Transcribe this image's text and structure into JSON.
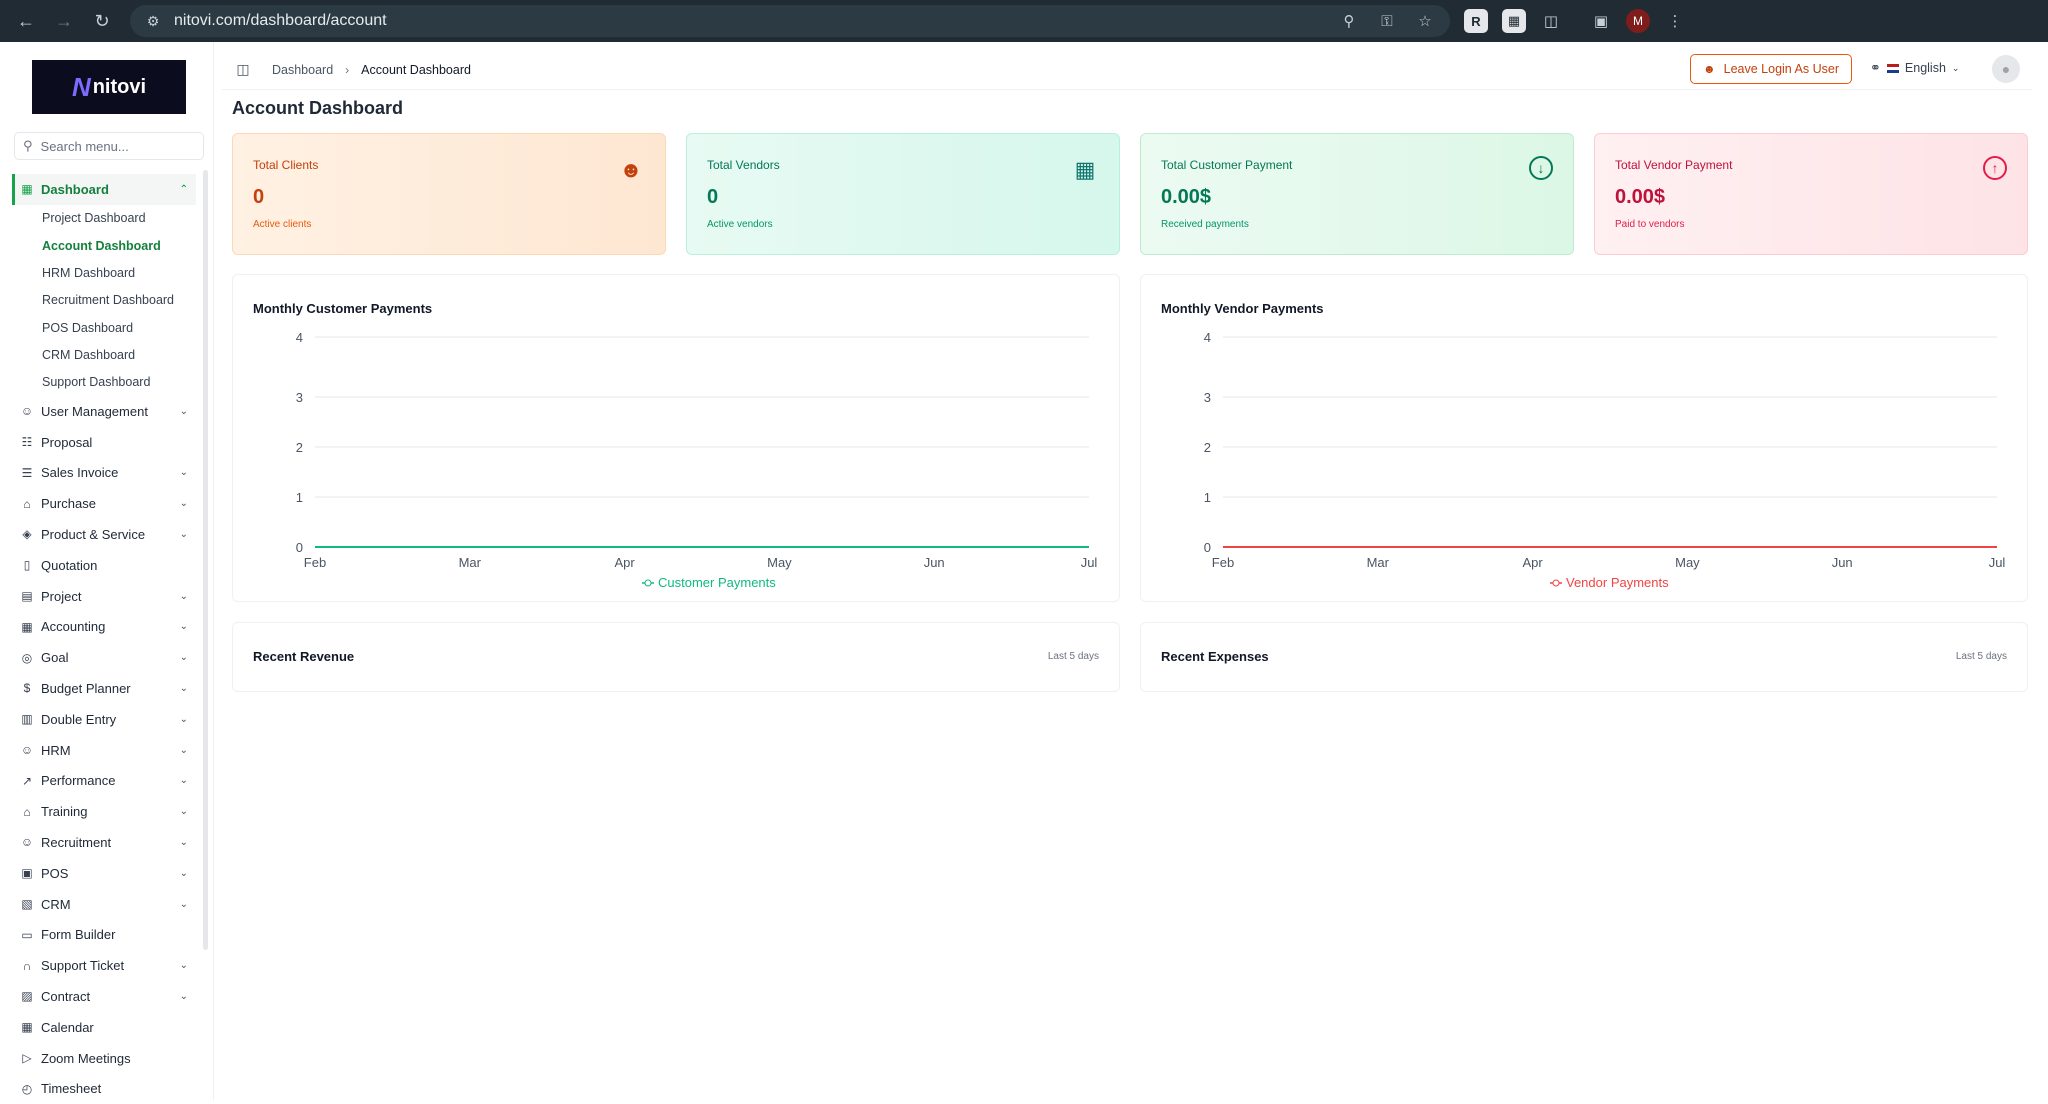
{
  "browser": {
    "url": "nitovi.com/dashboard/account",
    "profile_initial": "M"
  },
  "brand": {
    "logo_text": "nitovi",
    "logo_mark": "N"
  },
  "sidebar": {
    "search_placeholder": "Search menu...",
    "dashboard": {
      "label": "Dashboard",
      "children": [
        "Project Dashboard",
        "Account Dashboard",
        "HRM Dashboard",
        "Recruitment Dashboard",
        "POS Dashboard",
        "CRM Dashboard",
        "Support Dashboard"
      ]
    },
    "items": [
      {
        "label": "User Management",
        "icon": "users-icon",
        "expandable": true
      },
      {
        "label": "Proposal",
        "icon": "proposal-icon",
        "expandable": false
      },
      {
        "label": "Sales Invoice",
        "icon": "invoice-icon",
        "expandable": true
      },
      {
        "label": "Purchase",
        "icon": "cart-icon",
        "expandable": true
      },
      {
        "label": "Product & Service",
        "icon": "layers-icon",
        "expandable": true
      },
      {
        "label": "Quotation",
        "icon": "file-icon",
        "expandable": false
      },
      {
        "label": "Project",
        "icon": "folder-icon",
        "expandable": true
      },
      {
        "label": "Accounting",
        "icon": "calculator-icon",
        "expandable": true
      },
      {
        "label": "Goal",
        "icon": "target-icon",
        "expandable": true
      },
      {
        "label": "Budget Planner",
        "icon": "dollar-icon",
        "expandable": true
      },
      {
        "label": "Double Entry",
        "icon": "book-icon",
        "expandable": true
      },
      {
        "label": "HRM",
        "icon": "hrm-icon",
        "expandable": true
      },
      {
        "label": "Performance",
        "icon": "trend-icon",
        "expandable": true
      },
      {
        "label": "Training",
        "icon": "graduation-icon",
        "expandable": true
      },
      {
        "label": "Recruitment",
        "icon": "recruit-icon",
        "expandable": true
      },
      {
        "label": "POS",
        "icon": "store-icon",
        "expandable": true
      },
      {
        "label": "CRM",
        "icon": "crm-icon",
        "expandable": true
      },
      {
        "label": "Form Builder",
        "icon": "form-icon",
        "expandable": false
      },
      {
        "label": "Support Ticket",
        "icon": "headset-icon",
        "expandable": true
      },
      {
        "label": "Contract",
        "icon": "contract-icon",
        "expandable": true
      },
      {
        "label": "Calendar",
        "icon": "calendar-icon",
        "expandable": false
      },
      {
        "label": "Zoom Meetings",
        "icon": "video-icon",
        "expandable": false
      },
      {
        "label": "Timesheet",
        "icon": "clock-icon",
        "expandable": false
      }
    ]
  },
  "header": {
    "breadcrumb": [
      "Dashboard",
      "Account Dashboard"
    ],
    "leave_login_label": "Leave Login As User",
    "language": "English"
  },
  "page": {
    "title": "Account Dashboard"
  },
  "stats": {
    "clients": {
      "label": "Total Clients",
      "value": "0",
      "sub": "Active clients"
    },
    "vendors": {
      "label": "Total Vendors",
      "value": "0",
      "sub": "Active vendors"
    },
    "customer_payment": {
      "label": "Total Customer Payment",
      "value": "0.00$",
      "sub": "Received payments"
    },
    "vendor_payment": {
      "label": "Total Vendor Payment",
      "value": "0.00$",
      "sub": "Paid to vendors"
    }
  },
  "colors": {
    "accent_green": "#16a34a",
    "customer_line": "#10b981",
    "vendor_line": "#ef4444"
  },
  "chart_data": [
    {
      "type": "line",
      "title": "Monthly Customer Payments",
      "categories": [
        "Feb",
        "Mar",
        "Apr",
        "May",
        "Jun",
        "Jul"
      ],
      "series": [
        {
          "name": "Customer Payments",
          "values": [
            0,
            0,
            0,
            0,
            0,
            0
          ]
        }
      ],
      "ylim": [
        0,
        4
      ],
      "yticks": [
        0,
        1,
        2,
        3,
        4
      ],
      "grid": true,
      "legend": "bottom"
    },
    {
      "type": "line",
      "title": "Monthly Vendor Payments",
      "categories": [
        "Feb",
        "Mar",
        "Apr",
        "May",
        "Jun",
        "Jul"
      ],
      "series": [
        {
          "name": "Vendor Payments",
          "values": [
            0,
            0,
            0,
            0,
            0,
            0
          ]
        }
      ],
      "ylim": [
        0,
        4
      ],
      "yticks": [
        0,
        1,
        2,
        3,
        4
      ],
      "grid": true,
      "legend": "bottom"
    }
  ],
  "recent": {
    "revenue": {
      "title": "Recent Revenue",
      "range": "Last 5 days"
    },
    "expenses": {
      "title": "Recent Expenses",
      "range": "Last 5 days"
    }
  }
}
